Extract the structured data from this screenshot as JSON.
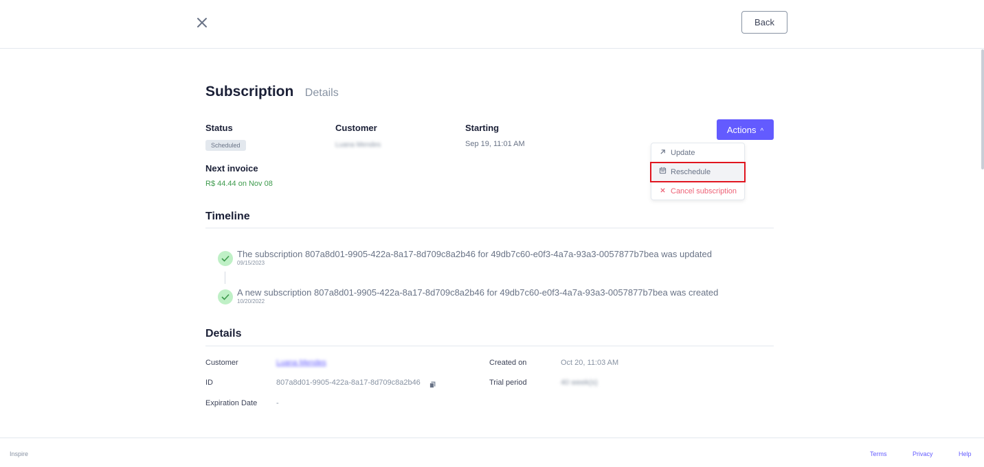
{
  "header": {
    "back_label": "Back"
  },
  "page": {
    "title": "Subscription",
    "subtitle": "Details"
  },
  "summary": {
    "status_label": "Status",
    "status_value": "Scheduled",
    "customer_label": "Customer",
    "customer_value": "Luana Mendes",
    "starting_label": "Starting",
    "starting_value": "Sep 19, 11:01 AM",
    "next_invoice_label": "Next invoice",
    "next_invoice_value": "R$ 44.44 on Nov 08"
  },
  "actions": {
    "button_label": "Actions",
    "items": [
      {
        "label": "Update",
        "icon": "arrow-up-right-icon"
      },
      {
        "label": "Reschedule",
        "icon": "calendar-icon"
      },
      {
        "label": "Cancel subscription",
        "icon": "close-icon"
      }
    ]
  },
  "timeline": {
    "title": "Timeline",
    "events": [
      {
        "text": "The subscription 807a8d01-9905-422a-8a17-8d709c8a2b46 for 49db7c60-e0f3-4a7a-93a3-0057877b7bea was updated",
        "date": "09/15/2023"
      },
      {
        "text": "A new subscription 807a8d01-9905-422a-8a17-8d709c8a2b46 for 49db7c60-e0f3-4a7a-93a3-0057877b7bea was created",
        "date": "10/20/2022"
      }
    ]
  },
  "details": {
    "title": "Details",
    "customer_label": "Customer",
    "customer_value": "Luana Mendes",
    "id_label": "ID",
    "id_value": "807a8d01-9905-422a-8a17-8d709c8a2b46",
    "expiration_label": "Expiration Date",
    "expiration_value": "-",
    "created_label": "Created on",
    "created_value": "Oct 20, 11:03 AM",
    "trial_label": "Trial period",
    "trial_value": "40 week(s)"
  },
  "footer": {
    "brand": "Inspire",
    "links": [
      "Terms",
      "Privacy",
      "Help"
    ]
  },
  "colors": {
    "accent": "#635bff",
    "success": "#3d9a4c",
    "danger": "#ed5f74",
    "highlight": "#e0141e"
  }
}
